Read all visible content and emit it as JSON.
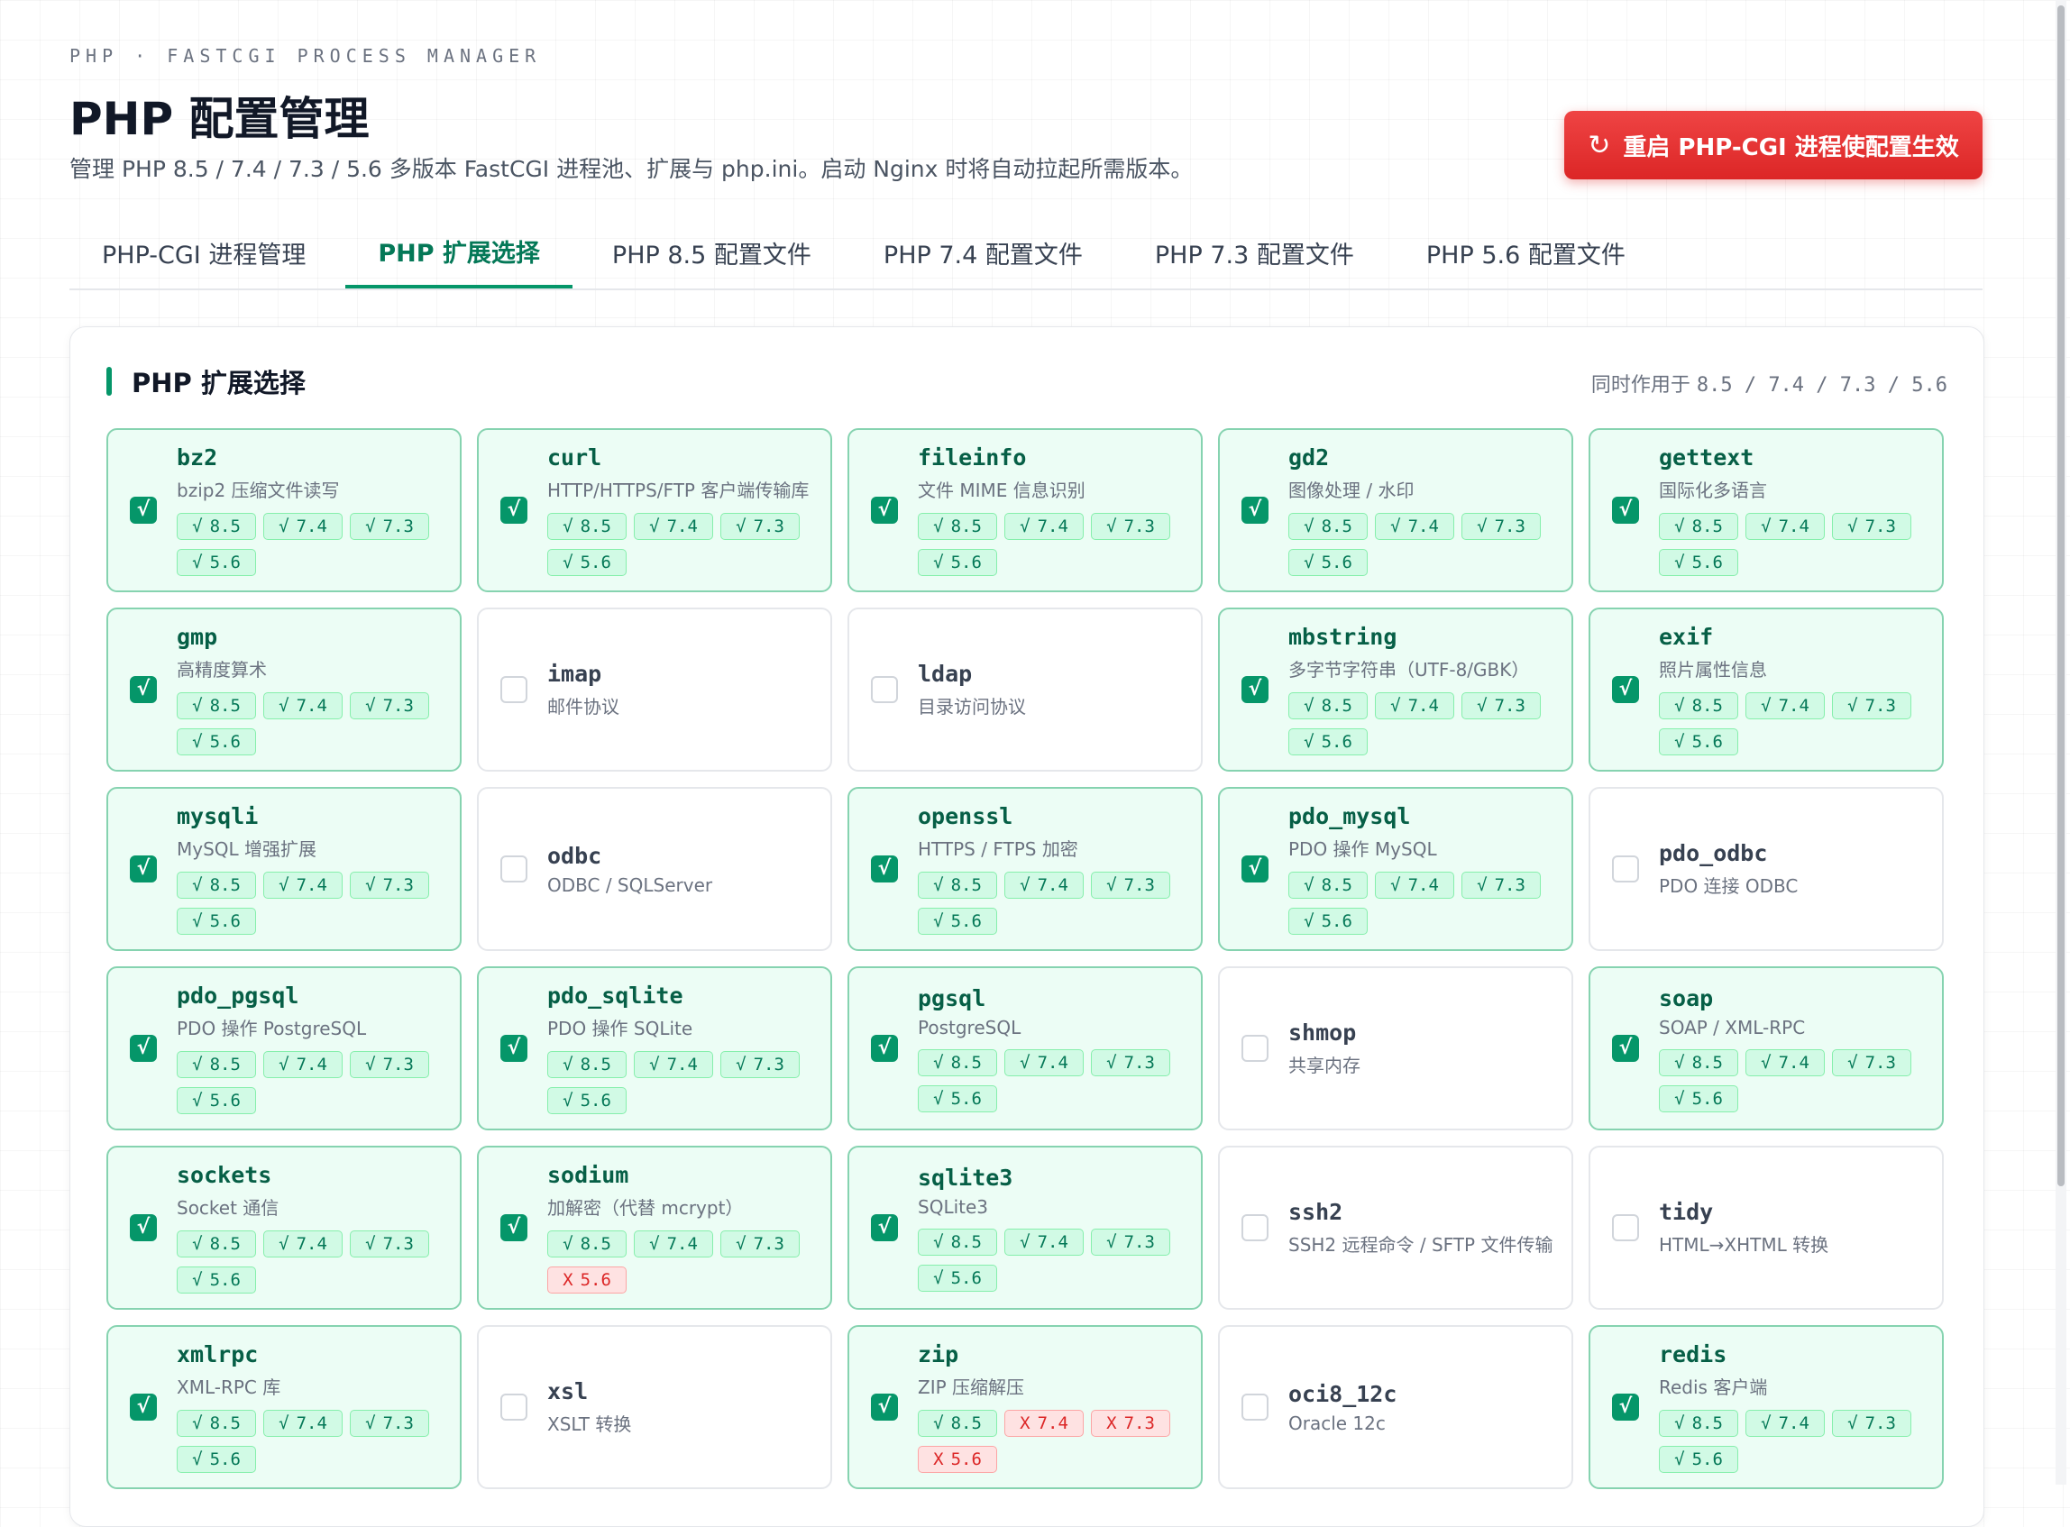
{
  "header": {
    "eyebrow": "PHP · FASTCGI PROCESS MANAGER",
    "title": "PHP 配置管理",
    "subtitle": "管理 PHP 8.5 / 7.4 / 7.3 / 5.6 多版本 FastCGI 进程池、扩展与 php.ini。启动 Nginx 时将自动拉起所需版本。",
    "restart_icon": "refresh-icon",
    "restart_label": "重启 PHP-CGI 进程使配置生效"
  },
  "tabs": [
    {
      "label": "PHP-CGI 进程管理",
      "active": false
    },
    {
      "label": "PHP 扩展选择",
      "active": true
    },
    {
      "label": "PHP 8.5 配置文件",
      "active": false
    },
    {
      "label": "PHP 7.4 配置文件",
      "active": false
    },
    {
      "label": "PHP 7.3 配置文件",
      "active": false
    },
    {
      "label": "PHP 5.6 配置文件",
      "active": false
    }
  ],
  "panel": {
    "title": "PHP 扩展选择",
    "scope_prefix": "同时作用于",
    "scope_versions": "8.5 / 7.4 / 7.3 / 5.6"
  },
  "marks": {
    "ok": "√",
    "bad": "X"
  },
  "extensions": [
    {
      "name": "bz2",
      "desc": "bzip2 压缩文件读写",
      "checked": true,
      "versions": [
        {
          "v": "8.5",
          "ok": true
        },
        {
          "v": "7.4",
          "ok": true
        },
        {
          "v": "7.3",
          "ok": true
        },
        {
          "v": "5.6",
          "ok": true
        }
      ]
    },
    {
      "name": "curl",
      "desc": "HTTP/HTTPS/FTP 客户端传输库",
      "checked": true,
      "versions": [
        {
          "v": "8.5",
          "ok": true
        },
        {
          "v": "7.4",
          "ok": true
        },
        {
          "v": "7.3",
          "ok": true
        },
        {
          "v": "5.6",
          "ok": true
        }
      ]
    },
    {
      "name": "fileinfo",
      "desc": "文件 MIME 信息识别",
      "checked": true,
      "versions": [
        {
          "v": "8.5",
          "ok": true
        },
        {
          "v": "7.4",
          "ok": true
        },
        {
          "v": "7.3",
          "ok": true
        },
        {
          "v": "5.6",
          "ok": true
        }
      ]
    },
    {
      "name": "gd2",
      "desc": "图像处理 / 水印",
      "checked": true,
      "versions": [
        {
          "v": "8.5",
          "ok": true
        },
        {
          "v": "7.4",
          "ok": true
        },
        {
          "v": "7.3",
          "ok": true
        },
        {
          "v": "5.6",
          "ok": true
        }
      ]
    },
    {
      "name": "gettext",
      "desc": "国际化多语言",
      "checked": true,
      "versions": [
        {
          "v": "8.5",
          "ok": true
        },
        {
          "v": "7.4",
          "ok": true
        },
        {
          "v": "7.3",
          "ok": true
        },
        {
          "v": "5.6",
          "ok": true
        }
      ]
    },
    {
      "name": "gmp",
      "desc": "高精度算术",
      "checked": true,
      "versions": [
        {
          "v": "8.5",
          "ok": true
        },
        {
          "v": "7.4",
          "ok": true
        },
        {
          "v": "7.3",
          "ok": true
        },
        {
          "v": "5.6",
          "ok": true
        }
      ]
    },
    {
      "name": "imap",
      "desc": "邮件协议",
      "checked": false,
      "versions": []
    },
    {
      "name": "ldap",
      "desc": "目录访问协议",
      "checked": false,
      "versions": []
    },
    {
      "name": "mbstring",
      "desc": "多字节字符串（UTF-8/GBK）",
      "checked": true,
      "versions": [
        {
          "v": "8.5",
          "ok": true
        },
        {
          "v": "7.4",
          "ok": true
        },
        {
          "v": "7.3",
          "ok": true
        },
        {
          "v": "5.6",
          "ok": true
        }
      ]
    },
    {
      "name": "exif",
      "desc": "照片属性信息",
      "checked": true,
      "versions": [
        {
          "v": "8.5",
          "ok": true
        },
        {
          "v": "7.4",
          "ok": true
        },
        {
          "v": "7.3",
          "ok": true
        },
        {
          "v": "5.6",
          "ok": true
        }
      ]
    },
    {
      "name": "mysqli",
      "desc": "MySQL 增强扩展",
      "checked": true,
      "versions": [
        {
          "v": "8.5",
          "ok": true
        },
        {
          "v": "7.4",
          "ok": true
        },
        {
          "v": "7.3",
          "ok": true
        },
        {
          "v": "5.6",
          "ok": true
        }
      ]
    },
    {
      "name": "odbc",
      "desc": "ODBC / SQLServer",
      "checked": false,
      "versions": []
    },
    {
      "name": "openssl",
      "desc": "HTTPS / FTPS 加密",
      "checked": true,
      "versions": [
        {
          "v": "8.5",
          "ok": true
        },
        {
          "v": "7.4",
          "ok": true
        },
        {
          "v": "7.3",
          "ok": true
        },
        {
          "v": "5.6",
          "ok": true
        }
      ]
    },
    {
      "name": "pdo_mysql",
      "desc": "PDO 操作 MySQL",
      "checked": true,
      "versions": [
        {
          "v": "8.5",
          "ok": true
        },
        {
          "v": "7.4",
          "ok": true
        },
        {
          "v": "7.3",
          "ok": true
        },
        {
          "v": "5.6",
          "ok": true
        }
      ]
    },
    {
      "name": "pdo_odbc",
      "desc": "PDO 连接 ODBC",
      "checked": false,
      "versions": []
    },
    {
      "name": "pdo_pgsql",
      "desc": "PDO 操作 PostgreSQL",
      "checked": true,
      "versions": [
        {
          "v": "8.5",
          "ok": true
        },
        {
          "v": "7.4",
          "ok": true
        },
        {
          "v": "7.3",
          "ok": true
        },
        {
          "v": "5.6",
          "ok": true
        }
      ]
    },
    {
      "name": "pdo_sqlite",
      "desc": "PDO 操作 SQLite",
      "checked": true,
      "versions": [
        {
          "v": "8.5",
          "ok": true
        },
        {
          "v": "7.4",
          "ok": true
        },
        {
          "v": "7.3",
          "ok": true
        },
        {
          "v": "5.6",
          "ok": true
        }
      ]
    },
    {
      "name": "pgsql",
      "desc": "PostgreSQL",
      "checked": true,
      "versions": [
        {
          "v": "8.5",
          "ok": true
        },
        {
          "v": "7.4",
          "ok": true
        },
        {
          "v": "7.3",
          "ok": true
        },
        {
          "v": "5.6",
          "ok": true
        }
      ]
    },
    {
      "name": "shmop",
      "desc": "共享内存",
      "checked": false,
      "versions": []
    },
    {
      "name": "soap",
      "desc": "SOAP / XML-RPC",
      "checked": true,
      "versions": [
        {
          "v": "8.5",
          "ok": true
        },
        {
          "v": "7.4",
          "ok": true
        },
        {
          "v": "7.3",
          "ok": true
        },
        {
          "v": "5.6",
          "ok": true
        }
      ]
    },
    {
      "name": "sockets",
      "desc": "Socket 通信",
      "checked": true,
      "versions": [
        {
          "v": "8.5",
          "ok": true
        },
        {
          "v": "7.4",
          "ok": true
        },
        {
          "v": "7.3",
          "ok": true
        },
        {
          "v": "5.6",
          "ok": true
        }
      ]
    },
    {
      "name": "sodium",
      "desc": "加解密（代替 mcrypt）",
      "checked": true,
      "versions": [
        {
          "v": "8.5",
          "ok": true
        },
        {
          "v": "7.4",
          "ok": true
        },
        {
          "v": "7.3",
          "ok": true
        },
        {
          "v": "5.6",
          "ok": false
        }
      ]
    },
    {
      "name": "sqlite3",
      "desc": "SQLite3",
      "checked": true,
      "versions": [
        {
          "v": "8.5",
          "ok": true
        },
        {
          "v": "7.4",
          "ok": true
        },
        {
          "v": "7.3",
          "ok": true
        },
        {
          "v": "5.6",
          "ok": true
        }
      ]
    },
    {
      "name": "ssh2",
      "desc": "SSH2 远程命令 / SFTP 文件传输",
      "checked": false,
      "versions": []
    },
    {
      "name": "tidy",
      "desc": "HTML→XHTML 转换",
      "checked": false,
      "versions": []
    },
    {
      "name": "xmlrpc",
      "desc": "XML-RPC 库",
      "checked": true,
      "versions": [
        {
          "v": "8.5",
          "ok": true
        },
        {
          "v": "7.4",
          "ok": true
        },
        {
          "v": "7.3",
          "ok": true
        },
        {
          "v": "5.6",
          "ok": true
        }
      ]
    },
    {
      "name": "xsl",
      "desc": "XSLT 转换",
      "checked": false,
      "versions": []
    },
    {
      "name": "zip",
      "desc": "ZIP 压缩解压",
      "checked": true,
      "versions": [
        {
          "v": "8.5",
          "ok": true
        },
        {
          "v": "7.4",
          "ok": false
        },
        {
          "v": "7.3",
          "ok": false
        },
        {
          "v": "5.6",
          "ok": false
        }
      ]
    },
    {
      "name": "oci8_12c",
      "desc": "Oracle 12c",
      "checked": false,
      "versions": []
    },
    {
      "name": "redis",
      "desc": "Redis 客户端",
      "checked": true,
      "versions": [
        {
          "v": "8.5",
          "ok": true
        },
        {
          "v": "7.4",
          "ok": true
        },
        {
          "v": "7.3",
          "ok": true
        },
        {
          "v": "5.6",
          "ok": true
        }
      ]
    }
  ],
  "colors": {
    "accent": "#059669",
    "danger": "#dc2626",
    "card_on_bg": "#ecfdf5"
  }
}
